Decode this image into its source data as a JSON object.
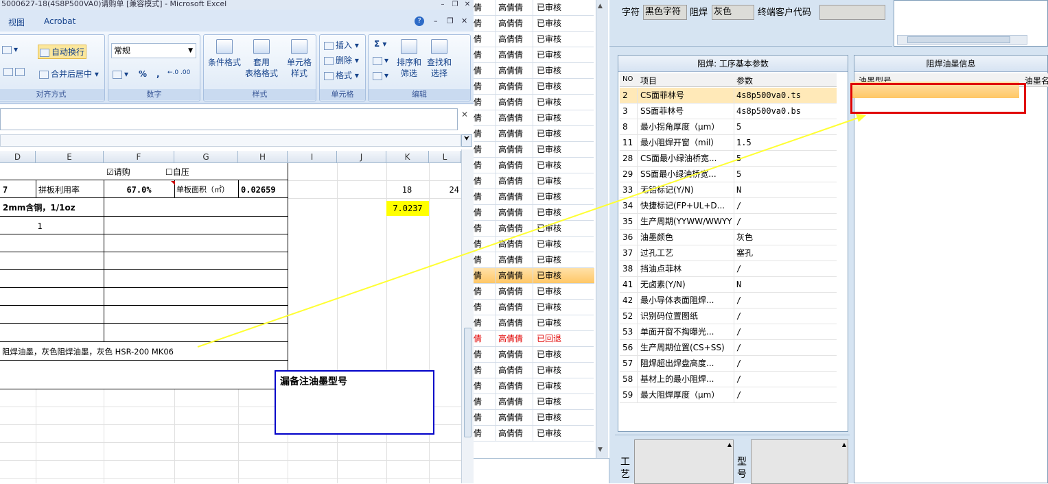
{
  "excel": {
    "title": "5000627-18(4S8P500VA0)请购单  [兼容模式] - Microsoft Excel",
    "win_min": "–",
    "win_restore": "❐",
    "win_close": "✕",
    "ribbon_min": "–",
    "ribbon_restore": "❐",
    "ribbon_close": "✕",
    "help": "?",
    "fbar_close": "✕",
    "menu": {
      "view": "视图",
      "acrobat": "Acrobat"
    },
    "ribbon": {
      "wrap": "自动换行",
      "merge": "合并后居中 ▾",
      "align_group": "对齐方式",
      "number_format": "常规",
      "number_group": "数字",
      "percent": "%",
      "comma": ",",
      "dec": "←.0 .00",
      "cond": "条件格式",
      "table": "套用\n表格格式",
      "cellstyle": "单元格\n样式",
      "style_group": "样式",
      "insert": "插入 ▾",
      "delete": "删除 ▾",
      "format": "格式 ▾",
      "cells_group": "单元格",
      "sum": "Σ ▾",
      "sort": "排序和\n筛选",
      "find": "查找和\n选择",
      "edit_group": "编辑"
    },
    "columns": [
      "D",
      "E",
      "F",
      "G",
      "H",
      "I",
      "J",
      "K",
      "L"
    ],
    "checkbox_purchase": "☑请购",
    "checkbox_press": "☐自压",
    "row1": {
      "d": "7",
      "e": "拼板利用率",
      "f": "67.0%",
      "g": "单板面积（㎡）",
      "h": "0.02659",
      "k": "18",
      "l": "24"
    },
    "row2": {
      "d": "2mm含铜，1/1oz",
      "k": "7.0237"
    },
    "row3": {
      "e": "1"
    },
    "ink_text": "阻焊油墨，灰色阻焊油墨，灰色 HSR-200 MK06",
    "note": "漏备注油墨型号"
  },
  "list": {
    "rows": [
      {
        "a": "倩",
        "b": "高倩倩",
        "c": "已审核"
      },
      {
        "a": "倩",
        "b": "高倩倩",
        "c": "已审核"
      },
      {
        "a": "倩",
        "b": "高倩倩",
        "c": "已审核"
      },
      {
        "a": "倩",
        "b": "高倩倩",
        "c": "已审核"
      },
      {
        "a": "倩",
        "b": "高倩倩",
        "c": "已审核"
      },
      {
        "a": "倩",
        "b": "高倩倩",
        "c": "已审核"
      },
      {
        "a": "倩",
        "b": "高倩倩",
        "c": "已审核"
      },
      {
        "a": "倩",
        "b": "高倩倩",
        "c": "已审核"
      },
      {
        "a": "倩",
        "b": "高倩倩",
        "c": "已审核"
      },
      {
        "a": "倩",
        "b": "高倩倩",
        "c": "已审核"
      },
      {
        "a": "倩",
        "b": "高倩倩",
        "c": "已审核"
      },
      {
        "a": "倩",
        "b": "高倩倩",
        "c": "已审核"
      },
      {
        "a": "倩",
        "b": "高倩倩",
        "c": "已审核"
      },
      {
        "a": "倩",
        "b": "高倩倩",
        "c": "已审核"
      },
      {
        "a": "倩",
        "b": "高倩倩",
        "c": "已审核"
      },
      {
        "a": "倩",
        "b": "高倩倩",
        "c": "已审核"
      },
      {
        "a": "倩",
        "b": "高倩倩",
        "c": "已审核"
      },
      {
        "a": "倩",
        "b": "高倩倩",
        "c": "已审核",
        "selected": true
      },
      {
        "a": "倩",
        "b": "高倩倩",
        "c": "已审核"
      },
      {
        "a": "倩",
        "b": "高倩倩",
        "c": "已审核"
      },
      {
        "a": "倩",
        "b": "高倩倩",
        "c": "已审核"
      },
      {
        "a": "倩",
        "b": "高倩倩",
        "c": "已回退",
        "returned": true
      },
      {
        "a": "倩",
        "b": "高倩倩",
        "c": "已审核"
      },
      {
        "a": "倩",
        "b": "高倩倩",
        "c": "已审核"
      },
      {
        "a": "倩",
        "b": "高倩倩",
        "c": "已审核"
      },
      {
        "a": "倩",
        "b": "高倩倩",
        "c": "已审核"
      },
      {
        "a": "倩",
        "b": "高倩倩",
        "c": "已审核"
      },
      {
        "a": "倩",
        "b": "高倩倩",
        "c": "已审核"
      }
    ]
  },
  "form": {
    "char_label": "字符",
    "char_value": "黑色字符",
    "mask_label": "阻焊",
    "mask_value": "灰色",
    "customer_label": "终端客户代码",
    "customer_value": ""
  },
  "params": {
    "title": "阻焊: 工序基本参数",
    "headers": {
      "no": "NO",
      "item": "项目",
      "value": "参数"
    },
    "rows": [
      {
        "no": "2",
        "item": "CS面菲林号",
        "value": "4s8p500va0.ts"
      },
      {
        "no": "3",
        "item": "SS面菲林号",
        "value": "4s8p500va0.bs"
      },
      {
        "no": "8",
        "item": "最小拐角厚度（μm）",
        "value": "5"
      },
      {
        "no": "11",
        "item": "最小阻焊开窗（mil）",
        "value": "1.5"
      },
      {
        "no": "28",
        "item": "CS面最小绿油桥宽...",
        "value": "5"
      },
      {
        "no": "29",
        "item": "SS面最小绿油桥宽...",
        "value": "5"
      },
      {
        "no": "33",
        "item": "无铅标记(Y/N)",
        "value": "N"
      },
      {
        "no": "34",
        "item": "快捷标记(FP+UL+D...",
        "value": "/"
      },
      {
        "no": "35",
        "item": "生产周期(YYWW/WWYY)",
        "value": "/"
      },
      {
        "no": "36",
        "item": "油墨颜色",
        "value": "灰色"
      },
      {
        "no": "37",
        "item": "过孔工艺",
        "value": "塞孔"
      },
      {
        "no": "38",
        "item": "挡油点菲林",
        "value": "/"
      },
      {
        "no": "41",
        "item": "无卤素(Y/N)",
        "value": "N"
      },
      {
        "no": "42",
        "item": "最小导体表面阻焊...",
        "value": "/"
      },
      {
        "no": "52",
        "item": "识别码位置图纸",
        "value": "/"
      },
      {
        "no": "53",
        "item": "单面开窗不掏曝光...",
        "value": "/"
      },
      {
        "no": "56",
        "item": "生产周期位置(CS+SS)",
        "value": "/"
      },
      {
        "no": "57",
        "item": "阻焊超出焊盘高度...",
        "value": "/"
      },
      {
        "no": "58",
        "item": "基材上的最小阻焊...",
        "value": "/"
      },
      {
        "no": "59",
        "item": "最大阻焊厚度（μm）",
        "value": "/"
      }
    ]
  },
  "ink": {
    "title": "阻焊油墨信息",
    "col1": "油墨型号",
    "col2": "油墨名"
  },
  "bottom": {
    "process_label": "工\n艺",
    "model_label": "型\n号"
  }
}
